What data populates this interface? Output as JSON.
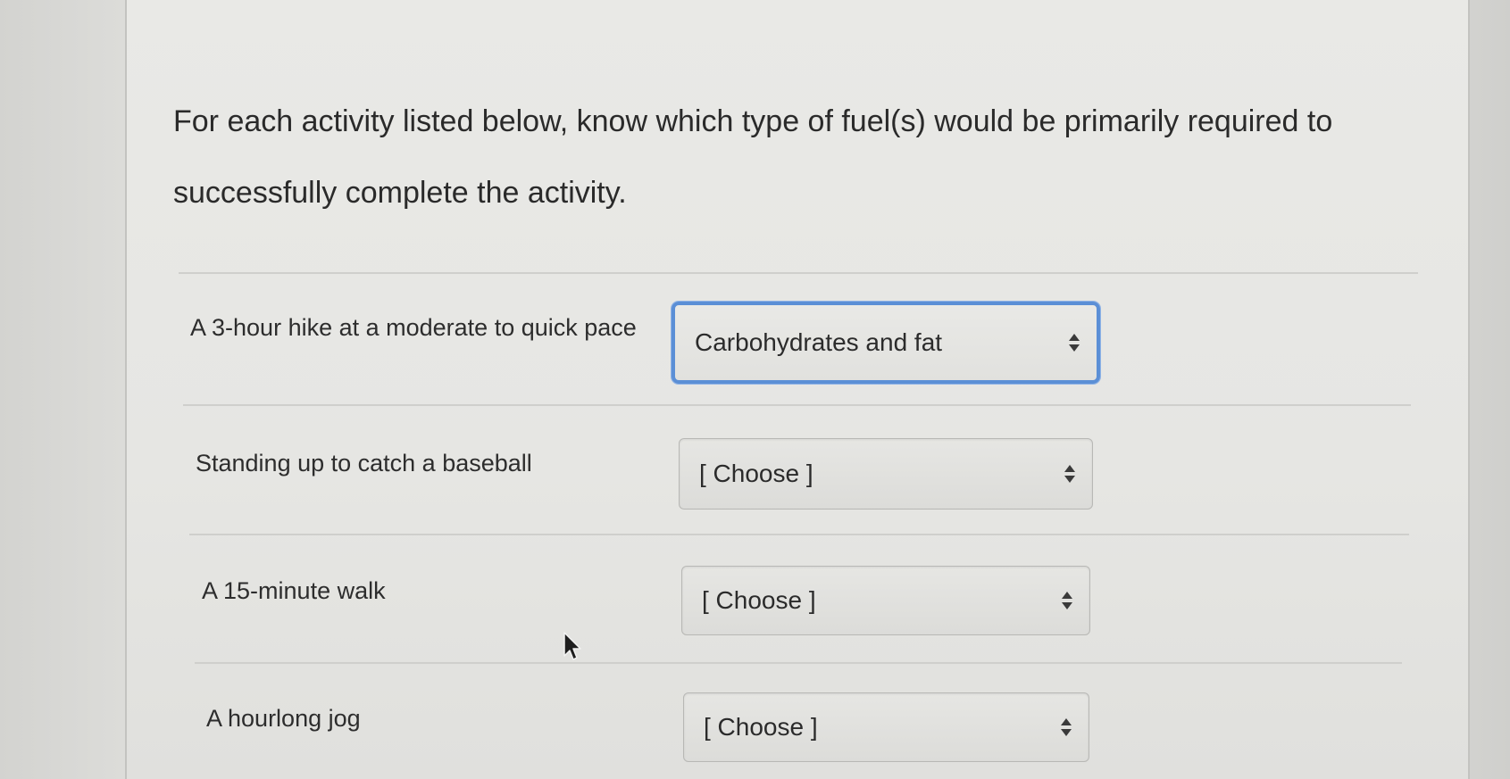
{
  "question": {
    "text": "For each activity listed below, know which type of fuel(s) would be primarily required to successfully complete the activity."
  },
  "items": [
    {
      "label": "A 3-hour hike at a moderate to quick pace",
      "selected": "Carbohydrates and fat",
      "focused": true
    },
    {
      "label": "Standing up to catch a baseball",
      "selected": "[ Choose ]",
      "focused": false
    },
    {
      "label": "A 15-minute walk",
      "selected": "[ Choose ]",
      "focused": false
    },
    {
      "label": "A hourlong jog",
      "selected": "[ Choose ]",
      "focused": false
    }
  ],
  "icons": {
    "select_arrows": "up-down-chevron-icon",
    "cursor": "mouse-pointer-icon"
  },
  "colors": {
    "focus_ring": "#5b8fd6",
    "text": "#2b2b2b"
  }
}
